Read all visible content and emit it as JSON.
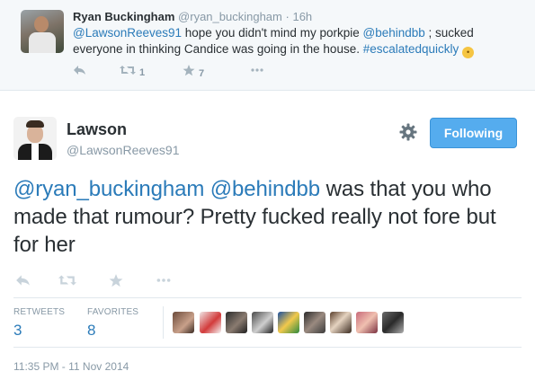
{
  "parent_tweet": {
    "name": "Ryan Buckingham",
    "handle": "@ryan_buckingham",
    "separator": "·",
    "time": "16h",
    "text_mention": "@LawsonReeves91",
    "text_part1": " hope you didn't mind my porkpie ",
    "text_mention2": "@behindbb",
    "text_part2": " ; sucked everyone in thinking Candice was going in the house. ",
    "text_hashtag": "#escalatedquickly",
    "retweet_count": "1",
    "favorite_count": "7",
    "actions": {
      "reply_icon": "reply-icon",
      "retweet_icon": "retweet-icon",
      "favorite_icon": "star-icon",
      "more_icon": "more-icon"
    }
  },
  "main_tweet": {
    "name": "Lawson",
    "handle": "@LawsonReeves91",
    "follow_label": "Following",
    "mention1": "@ryan_buckingham",
    "mention2": "@behindbb",
    "text_body": " was that you who made that rumour? Pretty fucked really not fore but for her",
    "stats": {
      "retweets_label": "RETWEETS",
      "retweets_value": "3",
      "favorites_label": "FAVORITES",
      "favorites_value": "8"
    },
    "favorited_by_count": 9,
    "timestamp": "11:35 PM - 11 Nov 2014"
  },
  "colors": {
    "link": "#2b7bb9",
    "follow_button": "#55acee",
    "meta_text": "#8899a6",
    "parent_bg": "#f5f8fa"
  }
}
